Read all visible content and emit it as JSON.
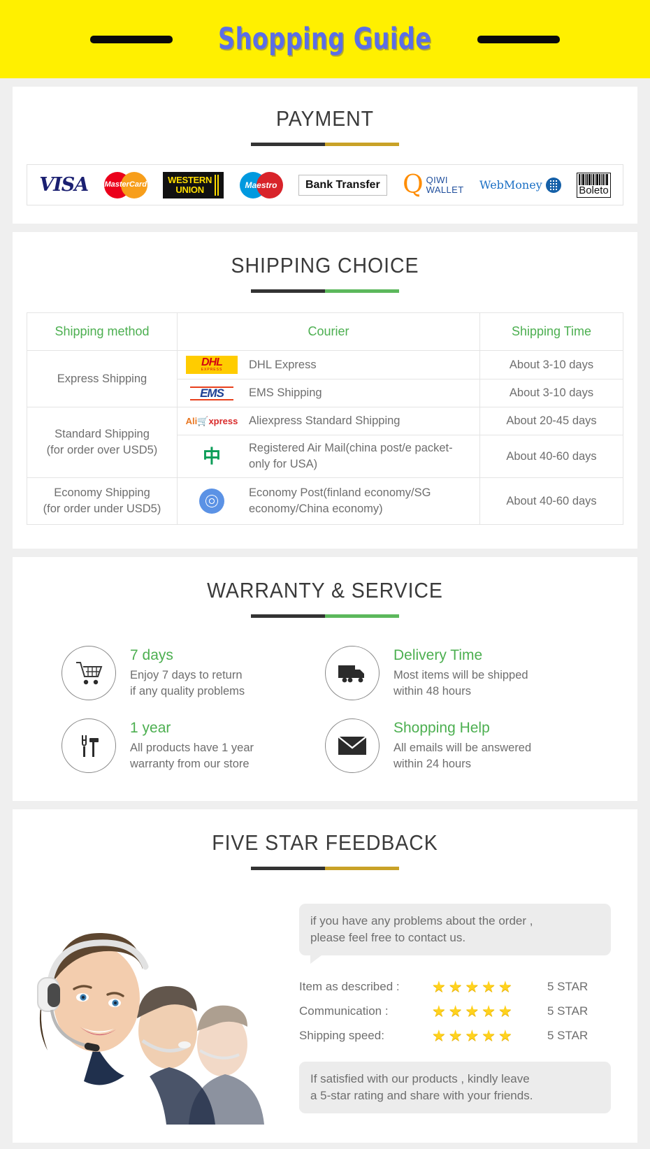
{
  "header": {
    "title": "Shopping Guide"
  },
  "payment": {
    "heading": "PAYMENT",
    "methods": [
      {
        "name": "VISA",
        "label": "VISA"
      },
      {
        "name": "MasterCard",
        "label": "MasterCard"
      },
      {
        "name": "Western Union",
        "line1": "WESTERN",
        "line2": "UNION"
      },
      {
        "name": "Maestro",
        "label": "Maestro"
      },
      {
        "name": "Bank Transfer",
        "label": "Bank Transfer"
      },
      {
        "name": "QIWI WALLET",
        "mark": "Q",
        "line1": "QIWI",
        "line2": "WALLET"
      },
      {
        "name": "WebMoney",
        "label": "WebMoney"
      },
      {
        "name": "Boleto",
        "label": "Boleto"
      }
    ]
  },
  "shipping": {
    "heading": "SHIPPING CHOICE",
    "columns": [
      "Shipping method",
      "Courier",
      "Shipping Time"
    ],
    "rows": [
      {
        "method": "Express Shipping",
        "method_note": "",
        "items": [
          {
            "logo": "dhl-logo",
            "courier": "DHL Express",
            "time": "About 3-10 days"
          },
          {
            "logo": "ems-logo",
            "courier": "EMS Shipping",
            "time": "About 3-10 days"
          }
        ]
      },
      {
        "method": "Standard Shipping",
        "method_note": "(for order over USD5)",
        "items": [
          {
            "logo": "aliexpress-logo",
            "courier": "Aliexpress Standard Shipping",
            "time": "About 20-45 days"
          },
          {
            "logo": "china-post-logo",
            "courier": "Registered Air Mail(china post/e packet-only for USA)",
            "time": "About 40-60 days"
          }
        ]
      },
      {
        "method": "Economy Shipping",
        "method_note": "(for order under USD5)",
        "items": [
          {
            "logo": "un-globe-logo",
            "courier": "Economy Post(finland economy/SG economy/China economy)",
            "time": "About 40-60 days"
          }
        ]
      }
    ],
    "logo_text": {
      "dhl": "DHL",
      "dhl_sub": "EXPRESS",
      "ems": "EMS",
      "ali_a": "Ali",
      "ali_x": "xpress"
    }
  },
  "warranty": {
    "heading": "WARRANTY & SERVICE",
    "features": [
      {
        "icon": "shopping-cart-icon",
        "title": "7 days",
        "line1": "Enjoy 7 days to return",
        "line2": "if any quality problems"
      },
      {
        "icon": "delivery-truck-icon",
        "title": "Delivery Time",
        "line1": "Most items will be shipped",
        "line2": "within 48 hours"
      },
      {
        "icon": "tools-icon",
        "title": "1 year",
        "line1": "All products have 1 year",
        "line2": "warranty from our store"
      },
      {
        "icon": "envelope-icon",
        "title": "Shopping Help",
        "line1": "All emails will be answered",
        "line2": "within 24 hours"
      }
    ]
  },
  "feedback": {
    "heading": "FIVE STAR FEEDBACK",
    "photo_alt": "call center agents with headsets",
    "top_bubble_line1": "if you have any problems about the order ,",
    "top_bubble_line2": "please feel free to contact us.",
    "ratings": [
      {
        "label": "Item as described :",
        "stars": 5,
        "value": "5 STAR"
      },
      {
        "label": "Communication :",
        "stars": 5,
        "value": "5 STAR"
      },
      {
        "label": "Shipping speed:",
        "stars": 5,
        "value": "5 STAR"
      }
    ],
    "bottom_bubble_line1": "If satisfied with our products ,  kindly leave",
    "bottom_bubble_line2": "a 5-star rating and share with your friends."
  },
  "colors": {
    "banner_bg": "#fff000",
    "banner_text": "#5b6ee6",
    "green": "#4caf50",
    "gold": "#c9a227",
    "dark": "#333333",
    "body_text": "#6e6e6e"
  }
}
